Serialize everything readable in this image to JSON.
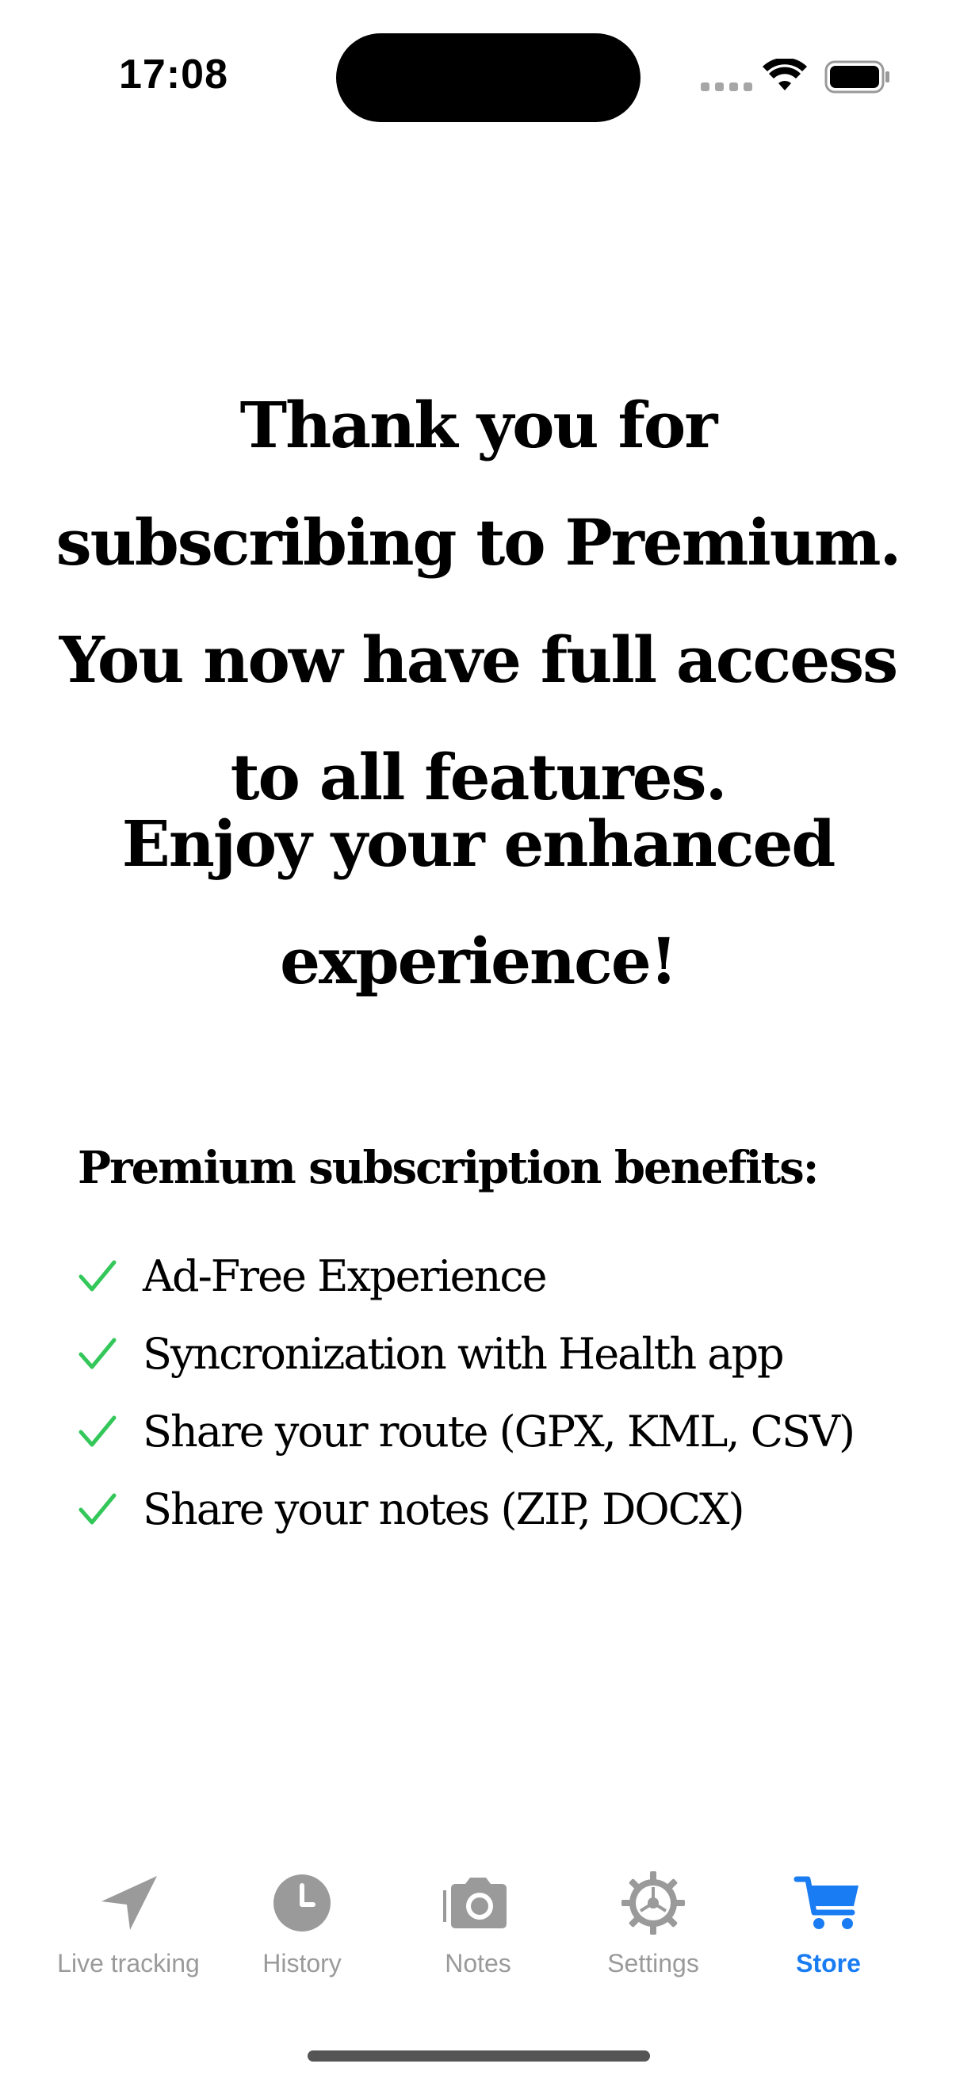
{
  "status_bar": {
    "time": "17:08"
  },
  "main": {
    "thanks_message": "Thank you for subscribing to Premium. You now have full access to all features.",
    "enjoy_message": "Enjoy your enhanced experience!",
    "benefits_title": "Premium subscription benefits:",
    "benefits": [
      "Ad-Free Experience",
      "Syncronization with Health app",
      "Share your route (GPX, KML, CSV)",
      "Share your notes (ZIP, DOCX)"
    ]
  },
  "tab_bar": {
    "tabs": [
      {
        "label": "Live tracking",
        "icon": "location-arrow-icon"
      },
      {
        "label": "History",
        "icon": "clock-icon"
      },
      {
        "label": "Notes",
        "icon": "camera-icon"
      },
      {
        "label": "Settings",
        "icon": "gear-icon"
      },
      {
        "label": "Store",
        "icon": "cart-icon",
        "active": true
      }
    ]
  },
  "colors": {
    "accent": "#1a7cf2",
    "inactive": "#9a9a9a",
    "check": "#34c759"
  }
}
